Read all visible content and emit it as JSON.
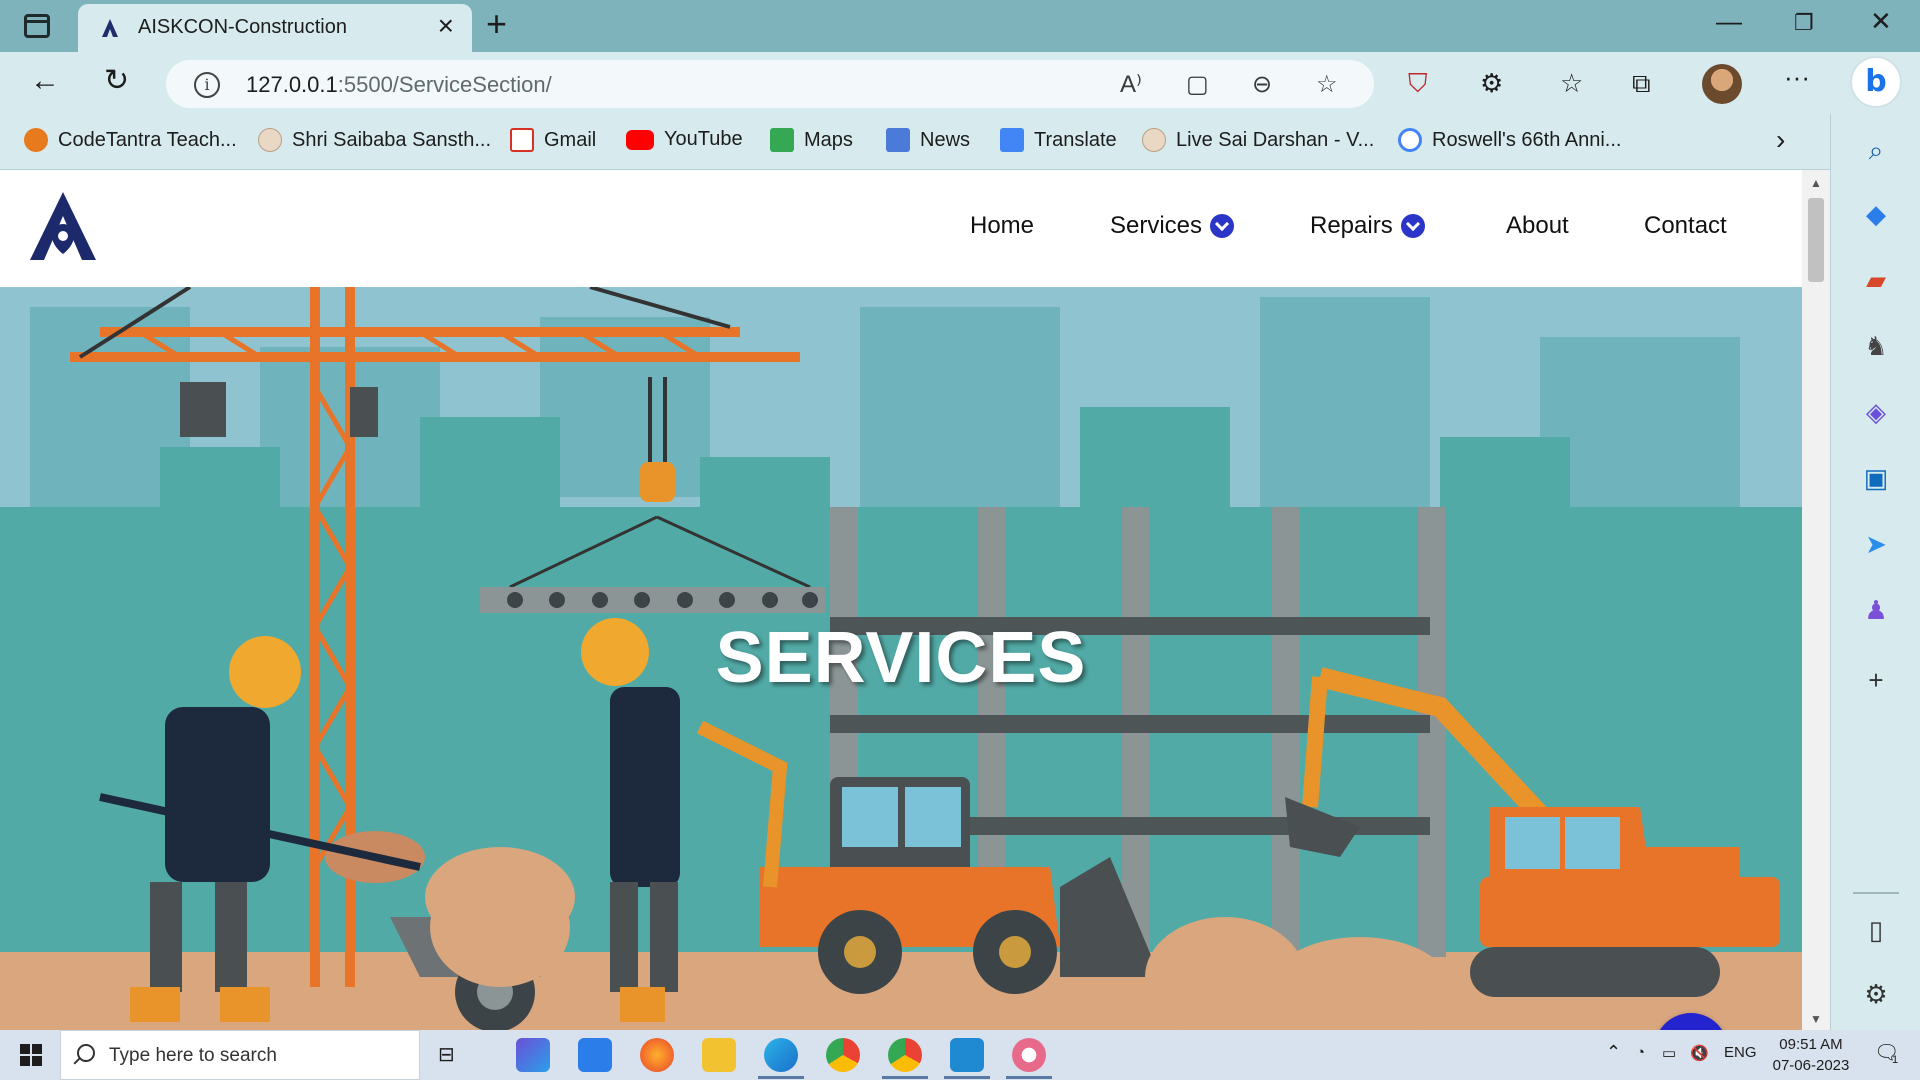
{
  "browser": {
    "tab_title": "AISKCON-Construction",
    "url_host": "127.0.0.1",
    "url_path": ":5500/ServiceSection/"
  },
  "bookmarks": [
    {
      "label": "CodeTantra Teach...",
      "color": "#e87a1e"
    },
    {
      "label": "Shri Saibaba Sansth...",
      "color": "#e8d8c4"
    },
    {
      "label": "Gmail",
      "color": "#d93025"
    },
    {
      "label": "YouTube",
      "color": "#ff0000"
    },
    {
      "label": "Maps",
      "color": "#34a853"
    },
    {
      "label": "News",
      "color": "#4a7bd9"
    },
    {
      "label": "Translate",
      "color": "#4285f4"
    },
    {
      "label": "Live Sai Darshan - V...",
      "color": "#e8d8c4"
    },
    {
      "label": "Roswell's 66th Anni...",
      "color": "#4285f4"
    }
  ],
  "site": {
    "nav": {
      "home": "Home",
      "services": "Services",
      "repairs": "Repairs",
      "about": "About",
      "contact": "Contact"
    },
    "hero_title": "SERVICES",
    "accent_color": "#2424cf"
  },
  "taskbar": {
    "search_placeholder": "Type here to search",
    "language": "ENG",
    "time": "09:51 AM",
    "date": "07-06-2023",
    "notification_count": "1"
  }
}
